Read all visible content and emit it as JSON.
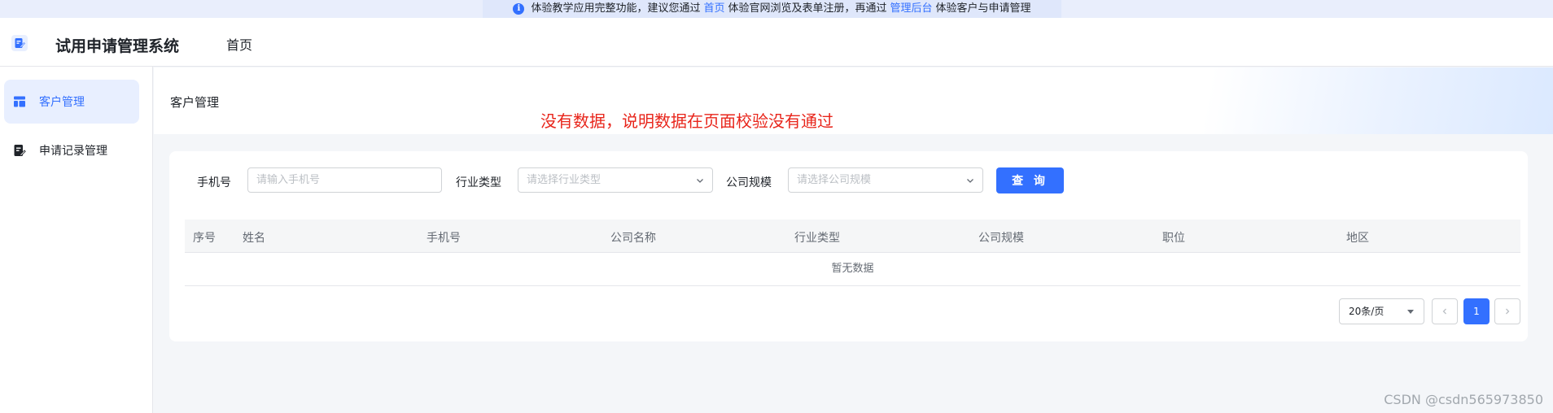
{
  "notice": {
    "text_before": "体验教学应用完整功能，建议您通过",
    "link_home": "首页",
    "text_middle": "体验官网浏览及表单注册，再通过",
    "link_admin": "管理后台",
    "text_after": "体验客户与申请管理"
  },
  "header": {
    "app_title": "试用申请管理系统",
    "nav_home": "首页"
  },
  "sidebar": {
    "items": [
      {
        "label": "客户管理",
        "icon": "layout-icon",
        "active": true
      },
      {
        "label": "申请记录管理",
        "icon": "edit-doc-icon",
        "active": false
      }
    ]
  },
  "page": {
    "title": "客户管理",
    "annotation": "没有数据，说明数据在页面校验没有通过"
  },
  "filters": {
    "phone_label": "手机号",
    "phone_placeholder": "请输入手机号",
    "industry_label": "行业类型",
    "industry_placeholder": "请选择行业类型",
    "scale_label": "公司规模",
    "scale_placeholder": "请选择公司规模",
    "query_button": "查 询"
  },
  "table": {
    "columns": [
      "序号",
      "姓名",
      "手机号",
      "公司名称",
      "行业类型",
      "公司规模",
      "职位",
      "地区"
    ],
    "empty_text": "暂无数据"
  },
  "pagination": {
    "page_size": "20条/页",
    "current_page": "1"
  },
  "watermark": "CSDN @csdn565973850",
  "colors": {
    "primary": "#3370ff",
    "annotation": "#e8251b"
  }
}
